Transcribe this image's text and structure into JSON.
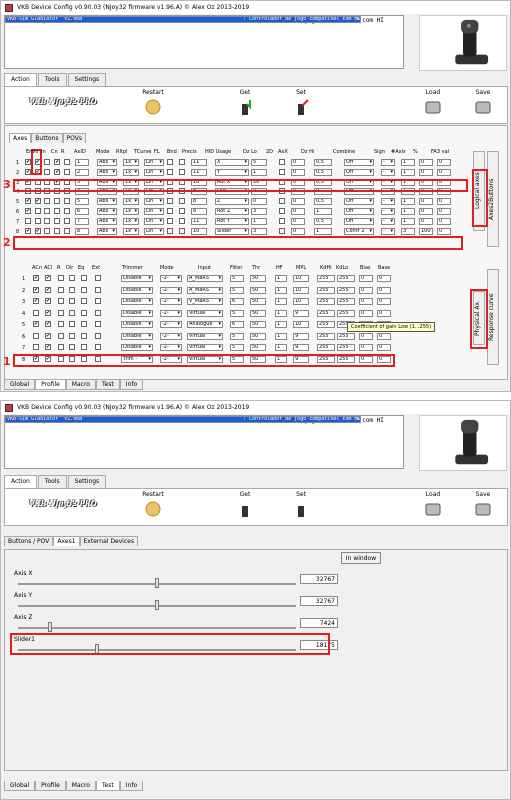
{
  "title": "VKB Device Config v0.90.03 (NJoy32 firmware v1.96.A) © Alex Oz 2013-2019",
  "devices": [
    {
      "name": "VKB-Sim Gladiator  v1.96B",
      "desc": ": Controlador de jogo compatível com HI"
    },
    {
      "name": "VKBsim Tiny BOX  v1.820",
      "desc": ": Controlador de jogo compatível com HI"
    }
  ],
  "main_tabs": [
    "Action",
    "Tools",
    "Settings"
  ],
  "logo": "VKB NJoy32 PRO",
  "toolbar": {
    "restart": "Restart",
    "get": "Get",
    "set": "Set",
    "load": "Load",
    "save": "Save"
  },
  "sub_tabs_top": [
    "Axes",
    "Buttons",
    "POVs"
  ],
  "axes_headers": [
    "En",
    "Vs",
    "In",
    "Cn",
    "R",
    "AxID",
    "Mode",
    "Rltpl",
    "TCurve",
    "FL",
    "Bnd",
    "Precis",
    "HID Usage",
    "Dz Lo",
    "2D",
    "AxX",
    "Dz Hi",
    "Combine",
    "Sign",
    "#Axis",
    "%",
    "FA3 val"
  ],
  "axes_rows": [
    {
      "n": "1",
      "en": "✔",
      "vs": "✔",
      "in": "",
      "cn": "✔",
      "r": "",
      "axid": "1",
      "mode": "Abs",
      "rlt": "1x",
      "tc": "Lin",
      "prec": "11",
      "hid": "X",
      "dzlo": "5",
      "axx": "0",
      "dzhi": "0,5",
      "comb": "Off",
      "sign": "-",
      "axis": "1",
      "pct": "0",
      "fa": "0"
    },
    {
      "n": "2",
      "en": "✔",
      "vs": "✔",
      "in": "",
      "cn": "✔",
      "r": "",
      "axid": "2",
      "mode": "Abs",
      "rlt": "1x",
      "tc": "Lin",
      "prec": "11",
      "hid": "Y",
      "dzlo": "1",
      "axx": "0",
      "dzhi": "0,5",
      "comb": "Off",
      "sign": "-",
      "axis": "1",
      "pct": "0",
      "fa": "0"
    },
    {
      "n": "3",
      "en": "✔",
      "vs": "",
      "in": "",
      "cn": "✔",
      "r": "",
      "axid": "3",
      "mode": "Abs",
      "rlt": "1x",
      "tc": "Lin",
      "prec": "10",
      "hid": "Rot X",
      "dzlo": "20",
      "axx": "0",
      "dzhi": "0,5",
      "comb": "Off",
      "sign": "-",
      "axis": "1",
      "pct": "0",
      "fa": "0"
    },
    {
      "n": "4",
      "en": "",
      "vs": "",
      "in": "",
      "cn": "",
      "r": "",
      "axid": "4",
      "mode": "Abs",
      "rlt": "1x",
      "tc": "Lin",
      "prec": "8",
      "hid": "Dial",
      "dzlo": "0",
      "axx": "0",
      "dzhi": "0",
      "comb": "Off",
      "sign": "-",
      "axis": "1",
      "pct": "0",
      "fa": "0"
    },
    {
      "n": "5",
      "en": "✔",
      "vs": "✔",
      "in": "",
      "cn": "",
      "r": "",
      "axid": "5",
      "mode": "Abs",
      "rlt": "1x",
      "tc": "Lin",
      "prec": "8",
      "hid": "Z",
      "dzlo": "0",
      "axx": "0",
      "dzhi": "0,5",
      "comb": "Off",
      "sign": "-",
      "axis": "1",
      "pct": "0",
      "fa": "0"
    },
    {
      "n": "6",
      "en": "✔",
      "vs": "",
      "in": "",
      "cn": "",
      "r": "",
      "axid": "6",
      "mode": "Abs",
      "rlt": "1x",
      "tc": "Lin",
      "prec": "8",
      "hid": "Rot Z",
      "dzlo": "3",
      "axx": "0",
      "dzhi": "1",
      "comb": "Off",
      "sign": "-",
      "axis": "1",
      "pct": "0",
      "fa": "0"
    },
    {
      "n": "7",
      "en": "",
      "vs": "",
      "in": "",
      "cn": "",
      "r": "",
      "axid": "7",
      "mode": "Abs",
      "rlt": "1x",
      "tc": "Lin",
      "prec": "11",
      "hid": "Rot Y",
      "dzlo": "1",
      "axx": "0",
      "dzhi": "0,5",
      "comb": "Off",
      "sign": "-",
      "axis": "1",
      "pct": "0",
      "fa": "0"
    },
    {
      "n": "8",
      "en": "✔",
      "vs": "✔",
      "in": "",
      "cn": "",
      "r": "",
      "axid": "8",
      "mode": "Abs",
      "rlt": "1x",
      "tc": "Lin",
      "prec": "10",
      "hid": "Slider",
      "dzlo": "3",
      "axx": "0",
      "dzhi": "1",
      "comb": "Contr 2",
      "sign": "-",
      "axis": "3",
      "pct": "100",
      "fa": "0"
    }
  ],
  "phys_headers": [
    "ACn",
    "ACl",
    "R",
    "Dir",
    "Eq",
    "Ext",
    "Trimmer",
    "Mode",
    "Input",
    "Filter",
    "Thr",
    "HF",
    "MPL",
    "KdHi",
    "KdLo",
    "Bias",
    "Base"
  ],
  "phys_rows": [
    {
      "n": "1",
      "acn": "✔",
      "acl": "✔",
      "trim": "Disable",
      "mode": "-2-",
      "input": "A_MaRS",
      "filter": "5",
      "thr": "50",
      "hf": "1",
      "mpl": "10",
      "kdhi": "255",
      "kdlo": "255",
      "bias": "0",
      "base": "0"
    },
    {
      "n": "2",
      "acn": "✔",
      "acl": "✔",
      "trim": "Disable",
      "mode": "-2-",
      "input": "A_MaRS",
      "filter": "5",
      "thr": "50",
      "hf": "1",
      "mpl": "10",
      "kdhi": "255",
      "kdlo": "255",
      "bias": "0",
      "base": "0"
    },
    {
      "n": "3",
      "acn": "✔",
      "acl": "✔",
      "trim": "Disable",
      "mode": "-2-",
      "input": "V_MaRS",
      "filter": "6",
      "thr": "50",
      "hf": "1",
      "mpl": "10",
      "kdhi": "255",
      "kdlo": "255",
      "bias": "0",
      "base": "0"
    },
    {
      "n": "4",
      "acn": "",
      "acl": "✔",
      "trim": "Disable",
      "mode": "-2-",
      "input": "Virtual",
      "filter": "5",
      "thr": "50",
      "hf": "1",
      "mpl": "9",
      "kdhi": "255",
      "kdlo": "255",
      "bias": "0",
      "base": "0"
    },
    {
      "n": "5",
      "acn": "✔",
      "acl": "✔",
      "trim": "Disable",
      "mode": "-2-",
      "input": "Analogue",
      "filter": "6",
      "thr": "50",
      "hf": "1",
      "mpl": "10",
      "kdhi": "255",
      "kdlo": "255",
      "bias": "0",
      "base": "0"
    },
    {
      "n": "6",
      "acn": "",
      "acl": "✔",
      "trim": "Disable",
      "mode": "-2-",
      "input": "Virtual",
      "filter": "5",
      "thr": "50",
      "hf": "1",
      "mpl": "9",
      "kdhi": "255",
      "kdlo": "255",
      "bias": "0",
      "base": "0"
    },
    {
      "n": "7",
      "acn": "",
      "acl": "✔",
      "trim": "Disable",
      "mode": "-2-",
      "input": "Virtual",
      "filter": "5",
      "thr": "50",
      "hf": "1",
      "mpl": "9",
      "kdhi": "255",
      "kdlo": "255",
      "bias": "0",
      "base": "0"
    },
    {
      "n": "8",
      "acn": "✔",
      "acl": "✔",
      "trim": "Trim -",
      "mode": "-2-",
      "input": "Virtual",
      "filter": "5",
      "thr": "50",
      "hf": "1",
      "mpl": "9",
      "kdhi": "255",
      "kdlo": "255",
      "bias": "0",
      "base": "0"
    }
  ],
  "tooltip": "Coefficient of gain Low (1...255)",
  "side_tabs": [
    "Logical axes",
    "Axes2Buttons",
    "Physical Ax.",
    "Response curve"
  ],
  "annotations": [
    "3",
    "2",
    "1"
  ],
  "bottom_tabs": [
    "Global",
    "Profile",
    "Macro",
    "Test",
    "Info"
  ],
  "test_tabs": [
    "Buttons / POV",
    "Axes1",
    "External Devices"
  ],
  "in_window": "In window",
  "axes_test": [
    {
      "label": "Axis X",
      "value": "32767",
      "pos": 0.5
    },
    {
      "label": "Axis Y",
      "value": "32767",
      "pos": 0.5
    },
    {
      "label": "Axis Z",
      "value": "7424",
      "pos": 0.11
    },
    {
      "label": "Slider1",
      "value": "18175",
      "pos": 0.28
    }
  ],
  "colors": {
    "selection": "#1e5bd6",
    "annotation": "#e02020"
  }
}
